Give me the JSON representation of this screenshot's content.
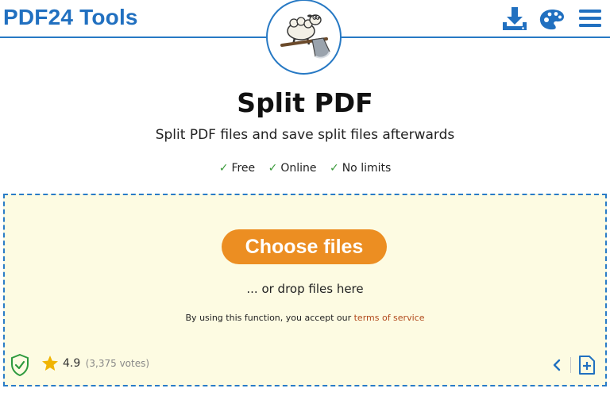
{
  "header": {
    "logo": "PDF24 Tools",
    "icons": [
      "download-icon",
      "palette-icon",
      "menu-icon"
    ]
  },
  "main": {
    "title": "Split PDF",
    "subtitle": "Split PDF files and save split files afterwards",
    "features": [
      "Free",
      "Online",
      "No limits"
    ],
    "check_mark": "✓"
  },
  "dropzone": {
    "choose_button": "Choose files",
    "drop_text": "... or drop files here",
    "terms_prefix": "By using this function, you accept our ",
    "terms_link": "terms of service",
    "rating_value": "4.9",
    "rating_votes": "(3,375 votes)"
  },
  "colors": {
    "brand_blue": "#2170c0",
    "button_orange": "#ec8e22",
    "dropzone_bg": "#fdfbe2",
    "check_green": "#3a9a3a",
    "star_gold": "#f0b400",
    "terms_link": "#b14a1c"
  }
}
